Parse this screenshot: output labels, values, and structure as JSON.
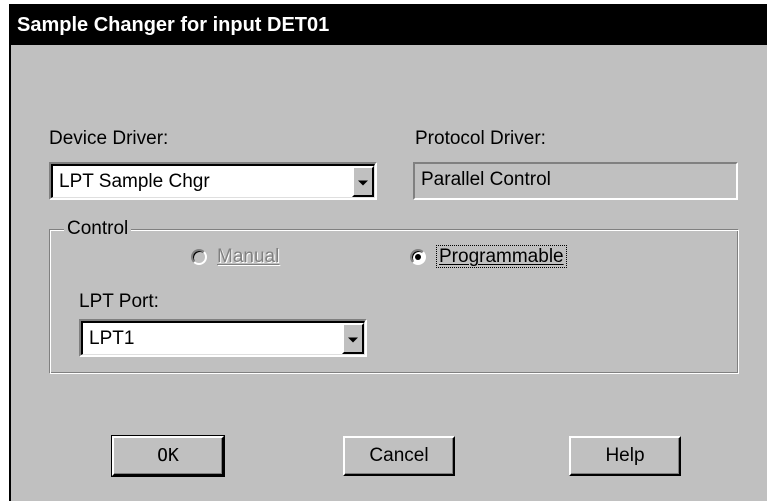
{
  "window": {
    "title": "Sample Changer for input DET01"
  },
  "device_driver": {
    "label": "Device Driver:",
    "value": "LPT Sample Chgr"
  },
  "protocol_driver": {
    "label": "Protocol Driver:",
    "value": "Parallel Control"
  },
  "control": {
    "legend": "Control",
    "manual_label": "Manual",
    "manual_selected": false,
    "manual_enabled": false,
    "programmable_label": "Programmable",
    "programmable_selected": true
  },
  "lpt_port": {
    "label": "LPT Port:",
    "value": "LPT1"
  },
  "buttons": {
    "ok": "OK",
    "cancel": "Cancel",
    "help": "Help"
  }
}
